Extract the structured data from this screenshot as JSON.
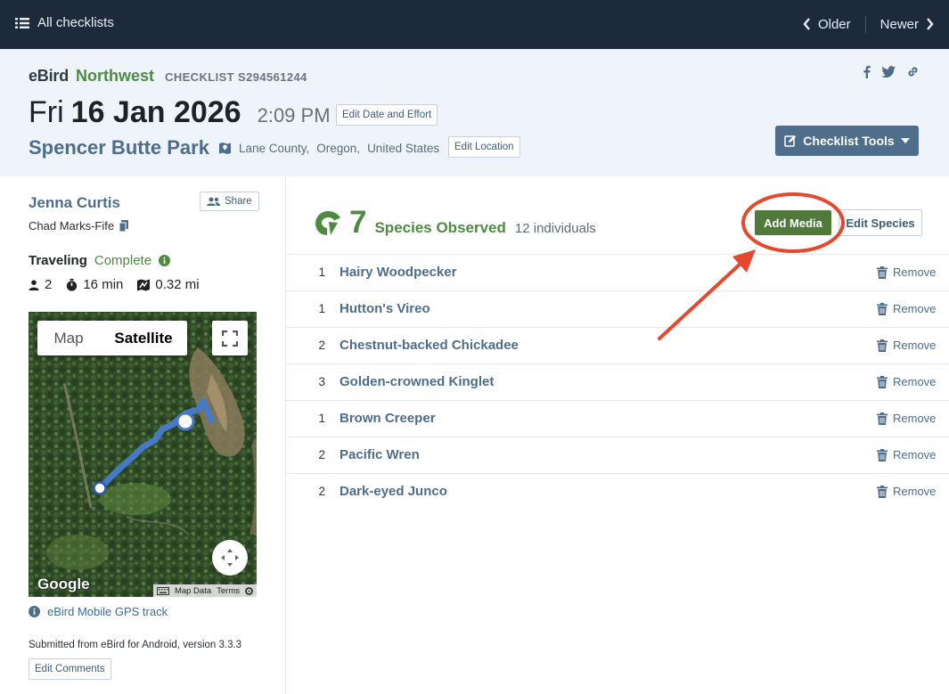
{
  "topbar": {
    "all_checklists": "All checklists",
    "older": "Older",
    "newer": "Newer"
  },
  "header": {
    "brand": "eBird",
    "region": "Northwest",
    "checklist_id": "CHECKLIST S294561244",
    "dow": "Fri",
    "date": "16 Jan 2026",
    "time": "2:09 PM",
    "edit_date_label": "Edit Date and Effort",
    "location": "Spencer Butte Park",
    "county": "Lane County,",
    "state": "Oregon,",
    "country": "United States",
    "edit_location_label": "Edit Location",
    "checklist_tools_label": "Checklist Tools"
  },
  "sidebar": {
    "observer": "Jenna Curtis",
    "share_label": "Share",
    "co_observer": "Chad Marks-Fife",
    "protocol": "Traveling",
    "status": "Complete",
    "observers_count": "2",
    "duration": "16 min",
    "distance": "0.32 mi",
    "map": {
      "map_label": "Map",
      "satellite_label": "Satellite",
      "google": "Google",
      "map_data": "Map Data",
      "terms": "Terms"
    },
    "gps_track": "eBird Mobile GPS track",
    "submitted": "Submitted from eBird for Android, version 3.3.3",
    "edit_comments_label": "Edit Comments"
  },
  "main": {
    "species_count": "7",
    "species_label": "Species Observed",
    "individuals": "12 individuals",
    "add_media_label": "Add Media",
    "edit_species_label": "Edit Species",
    "remove_label": "Remove",
    "species": [
      {
        "count": "1",
        "name": "Hairy Woodpecker"
      },
      {
        "count": "1",
        "name": "Hutton's Vireo"
      },
      {
        "count": "2",
        "name": "Chestnut-backed Chickadee"
      },
      {
        "count": "3",
        "name": "Golden-crowned Kinglet"
      },
      {
        "count": "1",
        "name": "Brown Creeper"
      },
      {
        "count": "2",
        "name": "Pacific Wren"
      },
      {
        "count": "2",
        "name": "Dark-eyed Junco"
      }
    ]
  },
  "colors": {
    "topbar": "#1c2a3b",
    "header_bg": "#eef4fa",
    "green": "#4f8a43",
    "link_blue": "#4e6d8b",
    "annotation_red": "#e2492d"
  },
  "icons": [
    "list-icon",
    "chevron-left-icon",
    "chevron-right-icon",
    "facebook-icon",
    "twitter-icon",
    "link-icon",
    "map-pin-icon",
    "edit-icon",
    "caret-down-icon",
    "share-people-icon",
    "clipboard-icon",
    "info-icon",
    "person-icon",
    "timer-icon",
    "map-route-icon",
    "fullscreen-icon",
    "pan-icon",
    "trash-icon",
    "ebird-logo-icon"
  ]
}
